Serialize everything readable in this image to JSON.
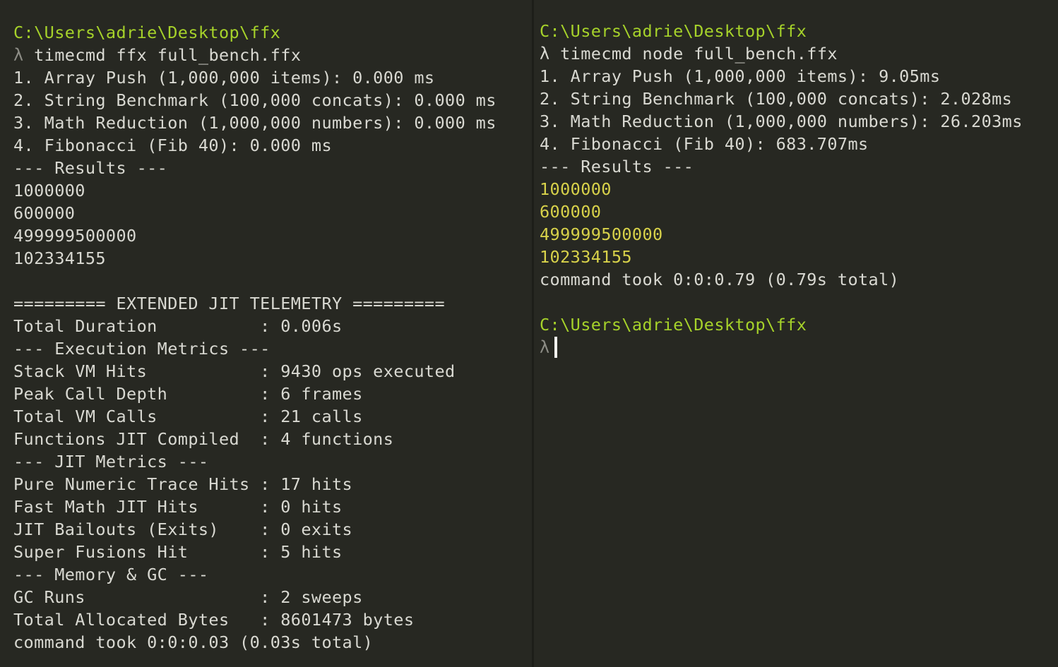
{
  "left_pane": {
    "path": "C:\\Users\\adrie\\Desktop\\ffx",
    "prompt_symbol": "λ",
    "command": "timecmd ffx full_bench.ffx",
    "output": [
      "1. Array Push (1,000,000 items): 0.000 ms",
      "2. String Benchmark (100,000 concats): 0.000 ms",
      "3. Math Reduction (1,000,000 numbers): 0.000 ms",
      "4. Fibonacci (Fib 40): 0.000 ms",
      "--- Results ---",
      "1000000",
      "600000",
      "499999500000",
      "102334155"
    ],
    "telemetry": [
      "========= EXTENDED JIT TELEMETRY =========",
      "Total Duration          : 0.006s",
      "--- Execution Metrics ---",
      "Stack VM Hits           : 9430 ops executed",
      "Peak Call Depth         : 6 frames",
      "Total VM Calls          : 21 calls",
      "Functions JIT Compiled  : 4 functions",
      "--- JIT Metrics ---",
      "Pure Numeric Trace Hits : 17 hits",
      "Fast Math JIT Hits      : 0 hits",
      "JIT Bailouts (Exits)    : 0 exits",
      "Super Fusions Hit       : 5 hits",
      "--- Memory & GC ---",
      "GC Runs                 : 2 sweeps",
      "Total Allocated Bytes   : 8601473 bytes",
      "command took 0:0:0.03 (0.03s total)"
    ]
  },
  "right_pane": {
    "path": "C:\\Users\\adrie\\Desktop\\ffx",
    "prompt_symbol": "λ",
    "command": "timecmd node full_bench.ffx",
    "output": [
      "1. Array Push (1,000,000 items): 9.05ms",
      "2. String Benchmark (100,000 concats): 2.028ms",
      "3. Math Reduction (1,000,000 numbers): 26.203ms",
      "4. Fibonacci (Fib 40): 683.707ms",
      "--- Results ---"
    ],
    "results": [
      "1000000",
      "600000",
      "499999500000",
      "102334155"
    ],
    "timing": "command took 0:0:0.79 (0.79s total)",
    "next_path": "C:\\Users\\adrie\\Desktop\\ffx",
    "next_prompt_symbol": "λ"
  },
  "colors": {
    "background": "#272822",
    "path": "#a6d22a",
    "results_highlight": "#d8d24a",
    "text": "#d9d9d2"
  }
}
